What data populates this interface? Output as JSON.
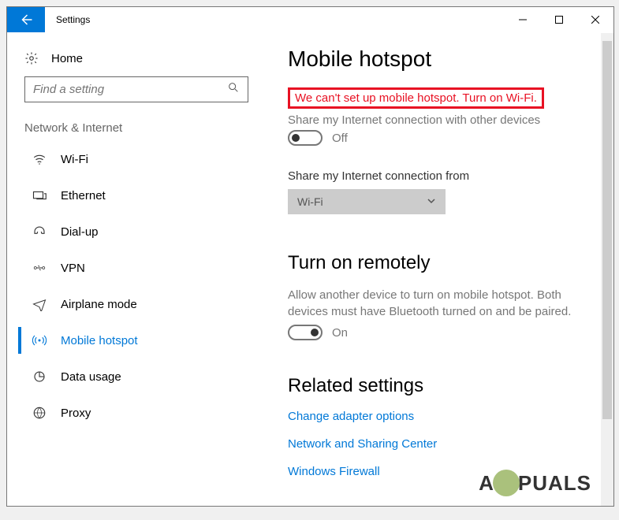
{
  "titlebar": {
    "app_title": "Settings"
  },
  "sidebar": {
    "home_label": "Home",
    "search_placeholder": "Find a setting",
    "section_title": "Network & Internet",
    "items": [
      {
        "label": "Wi-Fi"
      },
      {
        "label": "Ethernet"
      },
      {
        "label": "Dial-up"
      },
      {
        "label": "VPN"
      },
      {
        "label": "Airplane mode"
      },
      {
        "label": "Mobile hotspot"
      },
      {
        "label": "Data usage"
      },
      {
        "label": "Proxy"
      }
    ]
  },
  "content": {
    "heading": "Mobile hotspot",
    "error_message": "We can't set up mobile hotspot. Turn on Wi-Fi.",
    "share_label": "Share my Internet connection with other devices",
    "share_toggle_state": "Off",
    "share_from_label": "Share my Internet connection from",
    "share_from_value": "Wi-Fi",
    "remote_heading": "Turn on remotely",
    "remote_desc": "Allow another device to turn on mobile hotspot. Both devices must have Bluetooth turned on and be paired.",
    "remote_toggle_state": "On",
    "related_heading": "Related settings",
    "links": [
      "Change adapter options",
      "Network and Sharing Center",
      "Windows Firewall"
    ]
  },
  "watermark": {
    "prefix": "A",
    "suffix": "PUALS"
  }
}
